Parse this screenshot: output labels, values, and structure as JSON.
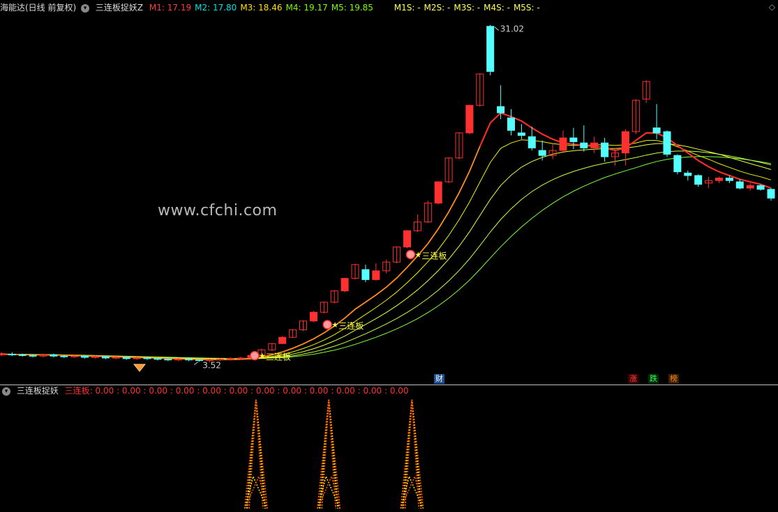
{
  "header": {
    "title": "海能达(日线 前复权)",
    "indicator_name": "三连板捉妖Z",
    "ma": [
      {
        "label": "M1",
        "value": "17.19",
        "color": "#ff3b3b"
      },
      {
        "label": "M2",
        "value": "17.80",
        "color": "#00e4e4"
      },
      {
        "label": "M3",
        "value": "18.46",
        "color": "#ffe000"
      },
      {
        "label": "M4",
        "value": "19.17",
        "color": "#7cfc00"
      },
      {
        "label": "M5",
        "value": "19.85",
        "color": "#7cfc00"
      }
    ],
    "ma_slope": [
      {
        "label": "M1S",
        "value": "-"
      },
      {
        "label": "M2S",
        "value": "-"
      },
      {
        "label": "M3S",
        "value": "-"
      },
      {
        "label": "M4S",
        "value": "-"
      },
      {
        "label": "M5S",
        "value": "-"
      }
    ],
    "ma_slope_color": "#ffff55"
  },
  "subpanel": {
    "name": "三连板捉妖",
    "label": "三连板",
    "values": [
      "0.00",
      "0.00",
      "0.00",
      "0.00",
      "0.00",
      "0.00",
      "0.00",
      "0.00",
      "0.00",
      "0.00",
      "0.00",
      "0.00"
    ]
  },
  "watermark": "www.cfchi.com",
  "markers": [
    {
      "text": "财",
      "color": "#ffffff",
      "bg": "#1d4f91"
    },
    {
      "text": "涨",
      "color": "#ff4040",
      "bg": "#3a0000"
    },
    {
      "text": "跌",
      "color": "#33ff66",
      "bg": "#002a00"
    },
    {
      "text": "榜",
      "color": "#ff8a00",
      "bg": "#3a1f00"
    }
  ],
  "chart_data": {
    "type": "candlestick",
    "y_high_label": "31.02",
    "y_low_label": "3.52",
    "signal_label": "三连板",
    "up_color": "#ff3030",
    "down_color": "#54ffff",
    "ylim": [
      3.0,
      32.0
    ],
    "candles": [
      [
        4.7,
        4.8,
        4.9,
        4.6
      ],
      [
        4.75,
        4.7,
        4.9,
        4.6
      ],
      [
        4.7,
        4.65,
        4.8,
        4.55
      ],
      [
        4.65,
        4.6,
        4.75,
        4.5
      ],
      [
        4.6,
        4.7,
        4.8,
        4.5
      ],
      [
        4.7,
        4.6,
        4.8,
        4.5
      ],
      [
        4.6,
        4.55,
        4.7,
        4.45
      ],
      [
        4.55,
        4.6,
        4.7,
        4.45
      ],
      [
        4.6,
        4.5,
        4.65,
        4.4
      ],
      [
        4.5,
        4.55,
        4.65,
        4.4
      ],
      [
        4.55,
        4.45,
        4.6,
        4.35
      ],
      [
        4.45,
        4.5,
        4.6,
        4.35
      ],
      [
        4.5,
        4.4,
        4.55,
        4.3
      ],
      [
        4.4,
        4.45,
        4.55,
        4.3
      ],
      [
        4.45,
        4.4,
        4.5,
        4.3
      ],
      [
        4.4,
        4.35,
        4.45,
        4.25
      ],
      [
        4.35,
        4.3,
        4.4,
        4.2
      ],
      [
        4.3,
        4.35,
        4.45,
        4.2
      ],
      [
        4.35,
        4.3,
        4.4,
        4.2
      ],
      [
        4.3,
        4.25,
        4.35,
        4.15
      ],
      [
        4.25,
        4.3,
        4.4,
        4.1
      ],
      [
        4.3,
        4.35,
        4.45,
        4.2
      ],
      [
        4.35,
        4.4,
        4.5,
        4.25
      ],
      [
        4.4,
        4.45,
        4.55,
        4.3
      ],
      [
        4.45,
        4.65,
        4.75,
        4.4
      ],
      [
        4.65,
        5.1,
        5.2,
        4.6
      ],
      [
        5.1,
        5.6,
        5.65,
        5.0
      ],
      [
        5.6,
        6.1,
        6.2,
        5.55
      ],
      [
        6.1,
        6.7,
        6.75,
        6.05
      ],
      [
        6.7,
        7.4,
        7.45,
        6.6
      ],
      [
        7.4,
        8.1,
        8.2,
        7.3
      ],
      [
        8.1,
        8.9,
        8.95,
        8.0
      ],
      [
        8.9,
        9.8,
        9.85,
        8.8
      ],
      [
        9.8,
        10.8,
        10.85,
        9.7
      ],
      [
        10.8,
        11.9,
        11.95,
        10.7
      ],
      [
        11.5,
        10.7,
        11.9,
        10.5
      ],
      [
        10.7,
        11.4,
        12.0,
        10.6
      ],
      [
        11.4,
        12.1,
        12.3,
        11.2
      ],
      [
        12.1,
        13.3,
        13.35,
        12.0
      ],
      [
        13.3,
        14.6,
        14.65,
        13.2
      ],
      [
        14.6,
        15.3,
        15.9,
        14.5
      ],
      [
        15.3,
        16.8,
        17.0,
        15.2
      ],
      [
        16.8,
        18.5,
        18.55,
        16.7
      ],
      [
        18.5,
        20.4,
        20.45,
        18.4
      ],
      [
        20.4,
        22.4,
        22.45,
        20.3
      ],
      [
        22.4,
        24.6,
        24.65,
        22.3
      ],
      [
        24.6,
        27.1,
        27.15,
        24.5
      ],
      [
        30.9,
        27.3,
        31.02,
        27.0
      ],
      [
        24.5,
        24.0,
        26.2,
        23.5
      ],
      [
        23.6,
        22.6,
        24.3,
        22.2
      ],
      [
        22.4,
        22.2,
        23.1,
        21.9
      ],
      [
        22.1,
        21.2,
        22.9,
        21.0
      ],
      [
        21.0,
        20.6,
        21.8,
        20.2
      ],
      [
        20.6,
        21.0,
        21.5,
        20.3
      ],
      [
        21.0,
        22.0,
        22.6,
        20.8
      ],
      [
        22.0,
        21.7,
        22.8,
        21.1
      ],
      [
        21.6,
        21.2,
        23.0,
        20.9
      ],
      [
        21.2,
        21.6,
        22.1,
        20.8
      ],
      [
        21.6,
        20.5,
        22.0,
        20.1
      ],
      [
        20.5,
        20.8,
        21.2,
        19.8
      ],
      [
        20.8,
        22.5,
        22.7,
        19.8
      ],
      [
        22.5,
        25.0,
        25.1,
        22.3
      ],
      [
        25.1,
        26.5,
        26.6,
        24.8
      ],
      [
        22.8,
        22.4,
        24.7,
        21.9
      ],
      [
        22.5,
        20.7,
        22.6,
        20.5
      ],
      [
        20.6,
        19.3,
        20.7,
        19.1
      ],
      [
        19.2,
        19.0,
        19.4,
        18.6
      ],
      [
        19.0,
        18.3,
        19.1,
        18.1
      ],
      [
        18.4,
        18.6,
        18.9,
        18.0
      ],
      [
        18.6,
        18.8,
        18.9,
        18.4
      ],
      [
        18.8,
        18.6,
        19.0,
        18.4
      ],
      [
        18.5,
        18.0,
        18.7,
        17.9
      ],
      [
        18.0,
        18.2,
        18.4,
        17.8
      ],
      [
        18.2,
        17.9,
        18.3,
        17.8
      ],
      [
        17.9,
        17.2,
        18.0,
        17.0
      ]
    ],
    "signal_days": [
      25,
      32,
      40
    ],
    "low_day": 22,
    "high_day": 47,
    "series": [
      {
        "name": "M1",
        "color": "#ff8c1a",
        "values": [
          4.75,
          4.74,
          4.72,
          4.7,
          4.7,
          4.69,
          4.67,
          4.65,
          4.62,
          4.6,
          4.57,
          4.55,
          4.52,
          4.49,
          4.47,
          4.44,
          4.41,
          4.39,
          4.36,
          4.34,
          4.32,
          4.32,
          4.33,
          4.35,
          4.4,
          4.52,
          4.7,
          4.93,
          5.22,
          5.57,
          5.98,
          6.45,
          7.0,
          7.63,
          8.34,
          8.9,
          9.47,
          10.1,
          10.83,
          11.68,
          12.59,
          13.57,
          14.75,
          16.1,
          17.63,
          19.34,
          21.32,
          23.2,
          23.99,
          23.7,
          23.35,
          22.8,
          22.3,
          21.9,
          21.6,
          21.5,
          21.4,
          21.35,
          21.2,
          21.0,
          21.2,
          21.8,
          22.4,
          22.4,
          22.0,
          21.4,
          20.8,
          20.2,
          19.7,
          19.3,
          19.0,
          18.7,
          18.5,
          18.3,
          18.0
        ]
      },
      {
        "name": "M2",
        "color": "#f2f200",
        "values": [
          4.75,
          4.74,
          4.73,
          4.71,
          4.7,
          4.69,
          4.67,
          4.65,
          4.63,
          4.61,
          4.59,
          4.56,
          4.54,
          4.51,
          4.49,
          4.46,
          4.44,
          4.41,
          4.39,
          4.37,
          4.35,
          4.34,
          4.34,
          4.35,
          4.38,
          4.45,
          4.57,
          4.73,
          4.94,
          5.2,
          5.51,
          5.88,
          6.31,
          6.81,
          7.37,
          7.92,
          8.47,
          9.06,
          9.71,
          10.45,
          11.25,
          12.12,
          13.1,
          14.22,
          15.48,
          16.89,
          18.48,
          20.05,
          21.17,
          21.6,
          21.85,
          21.8,
          21.7,
          21.55,
          21.45,
          21.4,
          21.4,
          21.45,
          21.45,
          21.4,
          21.45,
          21.6,
          21.8,
          21.8,
          21.6,
          21.3,
          20.95,
          20.6,
          20.3,
          19.95,
          19.65,
          19.35,
          19.1,
          18.9,
          18.65
        ]
      },
      {
        "name": "M3",
        "color": "#e6ff40",
        "values": [
          4.75,
          4.75,
          4.73,
          4.72,
          4.71,
          4.7,
          4.68,
          4.66,
          4.64,
          4.62,
          4.6,
          4.58,
          4.56,
          4.53,
          4.51,
          4.48,
          4.46,
          4.44,
          4.42,
          4.4,
          4.38,
          4.37,
          4.36,
          4.36,
          4.38,
          4.42,
          4.5,
          4.61,
          4.76,
          4.95,
          5.19,
          5.47,
          5.81,
          6.2,
          6.66,
          7.12,
          7.59,
          8.08,
          8.62,
          9.22,
          9.88,
          10.61,
          11.42,
          12.33,
          13.36,
          14.51,
          15.81,
          17.1,
          18.21,
          19.03,
          19.67,
          20.12,
          20.45,
          20.7,
          20.87,
          20.98,
          21.05,
          21.1,
          21.15,
          21.15,
          21.2,
          21.3,
          21.45,
          21.55,
          21.55,
          21.45,
          21.3,
          21.1,
          20.9,
          20.7,
          20.45,
          20.2,
          19.95,
          19.72,
          19.48
        ]
      },
      {
        "name": "M4",
        "color": "#c8ff40",
        "values": [
          4.75,
          4.75,
          4.74,
          4.73,
          4.72,
          4.71,
          4.69,
          4.67,
          4.65,
          4.64,
          4.62,
          4.6,
          4.57,
          4.55,
          4.53,
          4.51,
          4.49,
          4.47,
          4.45,
          4.43,
          4.41,
          4.4,
          4.39,
          4.39,
          4.39,
          4.41,
          4.46,
          4.53,
          4.63,
          4.76,
          4.93,
          5.14,
          5.39,
          5.68,
          6.02,
          6.38,
          6.76,
          7.16,
          7.6,
          8.08,
          8.61,
          9.2,
          9.86,
          10.6,
          11.43,
          12.36,
          13.41,
          14.5,
          15.5,
          16.35,
          17.1,
          17.72,
          18.24,
          18.67,
          19.03,
          19.33,
          19.58,
          19.8,
          19.98,
          20.12,
          20.27,
          20.44,
          20.63,
          20.79,
          20.9,
          20.95,
          20.95,
          20.9,
          20.82,
          20.7,
          20.56,
          20.4,
          20.23,
          20.05,
          19.85
        ]
      },
      {
        "name": "M5",
        "color": "#7dff3a",
        "values": [
          4.75,
          4.75,
          4.75,
          4.74,
          4.73,
          4.72,
          4.7,
          4.69,
          4.67,
          4.65,
          4.63,
          4.61,
          4.59,
          4.57,
          4.55,
          4.53,
          4.51,
          4.49,
          4.47,
          4.45,
          4.44,
          4.42,
          4.41,
          4.41,
          4.41,
          4.42,
          4.44,
          4.48,
          4.55,
          4.64,
          4.75,
          4.9,
          5.08,
          5.29,
          5.54,
          5.81,
          6.1,
          6.42,
          6.77,
          7.16,
          7.59,
          8.07,
          8.61,
          9.22,
          9.9,
          10.66,
          11.52,
          12.43,
          13.32,
          14.14,
          14.9,
          15.59,
          16.22,
          16.79,
          17.3,
          17.75,
          18.15,
          18.51,
          18.84,
          19.12,
          19.38,
          19.63,
          19.89,
          20.12,
          20.29,
          20.41,
          20.48,
          20.51,
          20.51,
          20.48,
          20.42,
          20.34,
          20.23,
          20.1,
          19.95
        ]
      }
    ]
  }
}
